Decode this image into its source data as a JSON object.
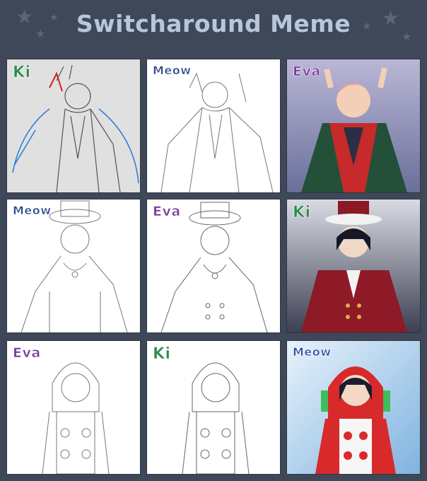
{
  "title": "Switcharound Meme",
  "panels": [
    {
      "artist": "Ki",
      "style": "sketch-blue"
    },
    {
      "artist": "Meow",
      "style": "lineart"
    },
    {
      "artist": "Eva",
      "style": "color-red"
    },
    {
      "artist": "Meow",
      "style": "lineart"
    },
    {
      "artist": "Eva",
      "style": "lineart"
    },
    {
      "artist": "Ki",
      "style": "color-dark"
    },
    {
      "artist": "Eva",
      "style": "lineart"
    },
    {
      "artist": "Ki",
      "style": "lineart"
    },
    {
      "artist": "Meow",
      "style": "color-hood"
    }
  ],
  "colors": {
    "background": "#3f4858",
    "title": "#b8c6dc",
    "ki": "#2c8a4a",
    "meow": "#2a4a8e",
    "eva": "#7a3f9c"
  }
}
